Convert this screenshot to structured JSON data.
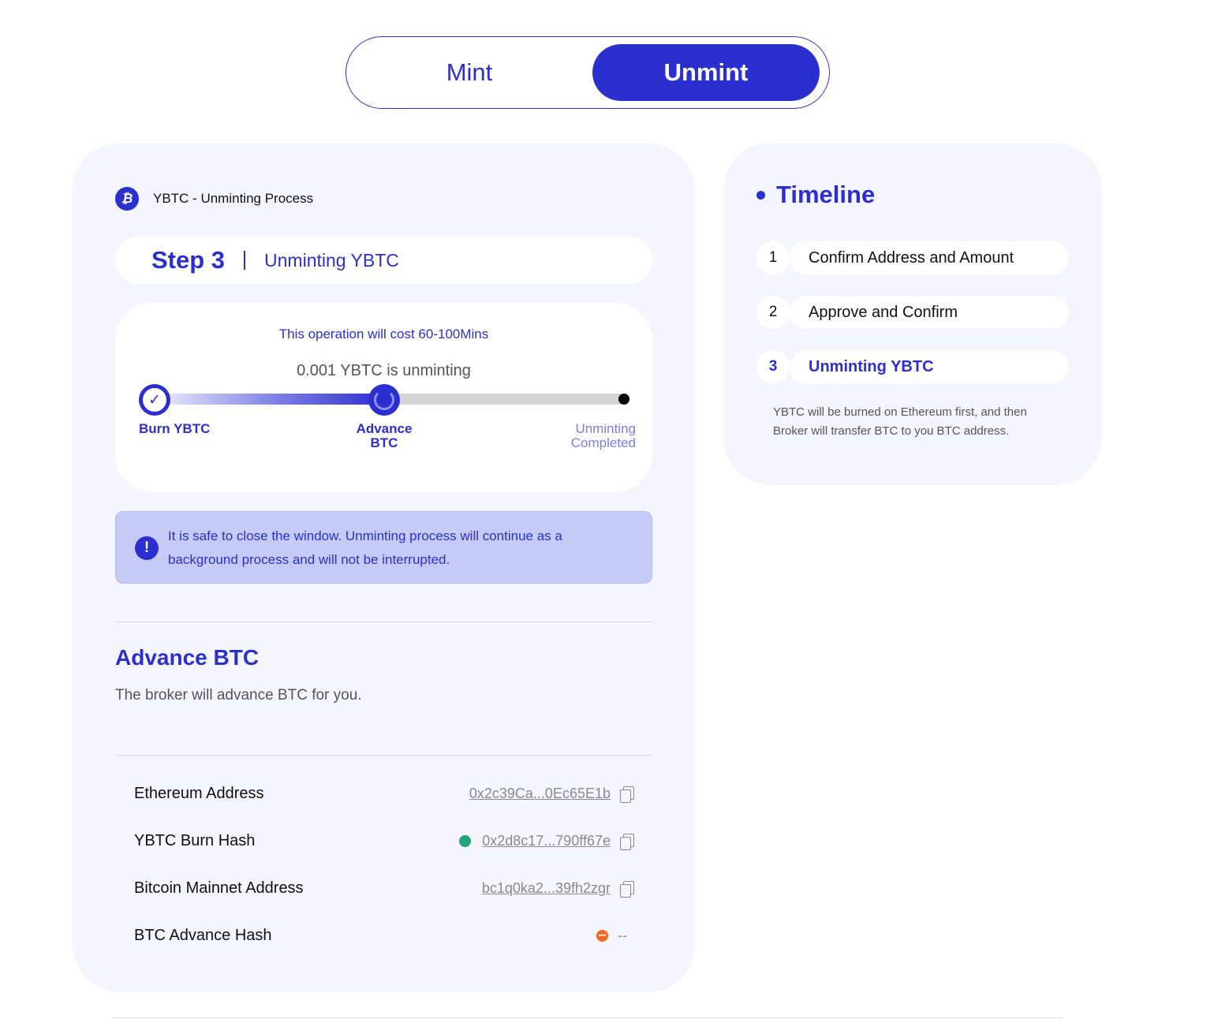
{
  "toggle": {
    "mint_label": "Mint",
    "unmint_label": "Unmint",
    "active": "Unmint"
  },
  "process": {
    "badge_icon": "bitcoin-icon",
    "title": "YBTC - Unminting Process",
    "step_number": "Step 3",
    "step_name": "Unminting YBTC",
    "cost_text": "This operation will cost 60-100Mins",
    "amount_text": "0.001 YBTC is unminting",
    "progress_fraction": 0.5,
    "stages": [
      {
        "label": "Burn YBTC",
        "status": "done"
      },
      {
        "label_line1": "Advance",
        "label_line2": "BTC",
        "status": "current"
      },
      {
        "label_line1": "Unminting",
        "label_line2": "Completed",
        "status": "pending"
      }
    ]
  },
  "notice": {
    "icon": "exclamation-icon",
    "text": "It is safe to close the window. Unminting process will continue as a background process and will not be interrupted."
  },
  "advance": {
    "title": "Advance BTC",
    "description": "The broker will advance BTC for you."
  },
  "details": [
    {
      "label": "Ethereum Address",
      "value": "0x2c39Ca...0Ec65E1b",
      "status": null
    },
    {
      "label": "YBTC Burn Hash",
      "value": "0x2d8c17...790ff67e",
      "status": "success"
    },
    {
      "label": "Bitcoin Mainnet Address",
      "value": "bc1q0ka2...39fh2zgr",
      "status": null
    },
    {
      "label": "BTC Advance Hash",
      "value": "--",
      "status": "pending"
    }
  ],
  "timeline": {
    "title": "Timeline",
    "items": [
      {
        "num": "1",
        "label": "Confirm Address and Amount"
      },
      {
        "num": "2",
        "label": "Approve and Confirm"
      },
      {
        "num": "3",
        "label": "Unminting YBTC"
      }
    ],
    "active_index": 2,
    "note": "YBTC will be burned on Ethereum first, and then Broker will transfer BTC to you BTC address."
  },
  "colors": {
    "accent": "#2c2fcf",
    "panel": "#f4f5fe",
    "notice_bg": "#c5cbf6",
    "success": "#23a37a",
    "pending": "#f26b1d"
  }
}
